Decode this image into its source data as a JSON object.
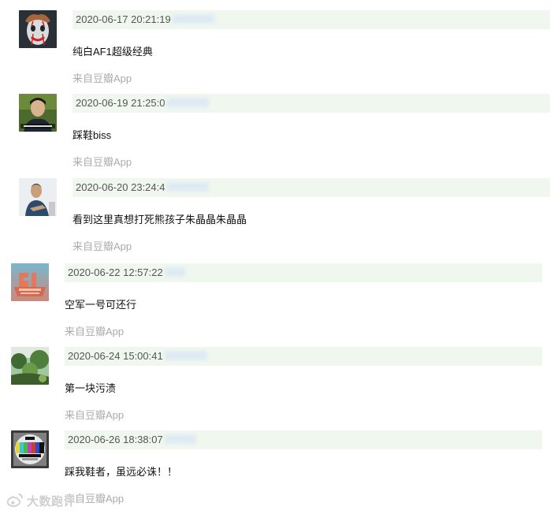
{
  "comments": [
    {
      "time": "2020-06-17 20:21:19",
      "content": "纯白AF1超级经典",
      "source": "来自豆瓣App",
      "avatar_icon": "clown-portrait-icon"
    },
    {
      "time": "2020-06-19 21:25:0",
      "content": "踩鞋biss",
      "source": "来自豆瓣App",
      "avatar_icon": "man-portrait-icon"
    },
    {
      "time": "2020-06-20 23:24:4",
      "content": "看到这里真想打死熊孩子朱晶晶朱晶晶",
      "source": "来自豆瓣App",
      "avatar_icon": "man-sitting-icon"
    },
    {
      "time": "2020-06-22 12:57:22",
      "content": "空军一号可还行",
      "source": "来自豆瓣App",
      "avatar_icon": "century-fox-logo-icon"
    },
    {
      "time": "2020-06-24 15:00:41",
      "content": "第一块污渍",
      "source": "来自豆瓣App",
      "avatar_icon": "garden-icon"
    },
    {
      "time": "2020-06-26 18:38:07",
      "content": "踩我鞋者，虽远必诛！！",
      "source": "来自豆瓣App",
      "avatar_icon": "tv-test-card-icon"
    }
  ],
  "watermark": {
    "text": "大数跑评",
    "icon": "weibo-logo-icon"
  }
}
